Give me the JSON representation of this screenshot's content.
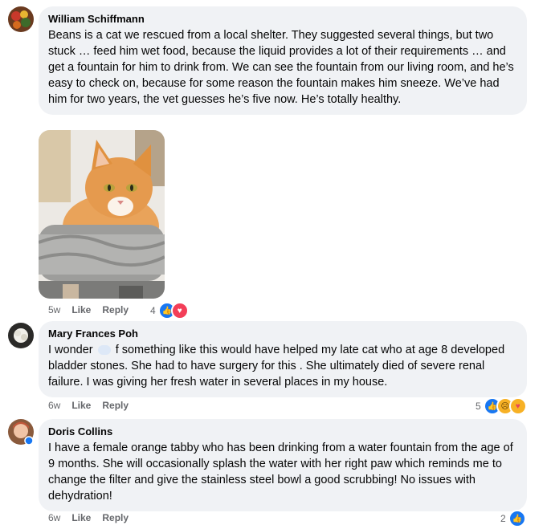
{
  "comments": [
    {
      "author": "William Schiffmann",
      "text": "Beans is a cat we rescued from a local shelter. They suggested several things, but two stuck … feed him wet food, because the liquid provides a lot of their requirements … and get a fountain for him to drink from. We can see the fountain from our living room, and he’s easy to check on, because for some reason the fountain makes him sneeze. We’ve had him for two years, the vet guesses he’s five now. He’s totally healthy.",
      "time": "5w",
      "like": "Like",
      "reply": "Reply",
      "reaction_count": "4",
      "reactions": [
        "like-icon",
        "love-icon"
      ]
    },
    {
      "author": "Mary Frances Poh",
      "text_before": "I wonder",
      "text_after": "f something like this would have helped my late cat who at age 8 developed bladder stones. She had to have surgery for this . She ultimately died of severe renal failure. I was giving her fresh water in several places in my house.",
      "time": "6w",
      "like": "Like",
      "reply": "Reply",
      "reaction_count": "5",
      "reactions": [
        "like-icon",
        "sad-icon",
        "care-icon"
      ]
    },
    {
      "author": "Doris Collins",
      "text": "I have a female orange tabby who has been drinking from a water fountain from the age of 9 months. She will occasionally splash the water with her right paw which reminds me to change the filter and give the stainless steel bowl a good scrubbing! No issues with dehydration!",
      "time": "6w",
      "like": "Like",
      "reply": "Reply",
      "reaction_count": "2",
      "reactions": [
        "like-icon"
      ]
    }
  ],
  "colors": {
    "bubble": "#f0f2f5",
    "meta": "#65676b",
    "like": "#1877f2",
    "love": "#f33e58",
    "sad": "#f7b125"
  }
}
